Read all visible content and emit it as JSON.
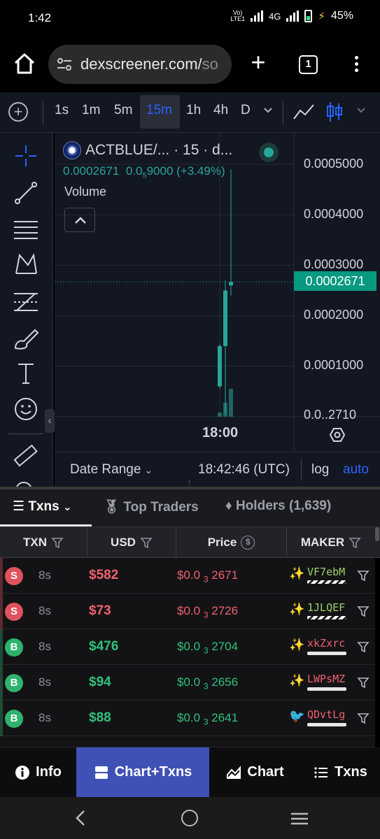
{
  "status_bar": {
    "time": "1:42",
    "volte": "VoLTE1",
    "network": "4G",
    "battery": "45%"
  },
  "browser": {
    "url_main": "dexscreener.com/",
    "url_fade": "so",
    "tab_count": "1"
  },
  "chart_toolbar": {
    "intervals": [
      "1s",
      "1m",
      "5m",
      "15m",
      "1h",
      "4h",
      "D"
    ],
    "active_interval": "15m"
  },
  "chart": {
    "legend_title": "ACTBLUE/...",
    "legend_interval": "· 15 · d...",
    "legend_open": "0.0002671",
    "legend_change_prefix": "0.0",
    "legend_change_sub": "5",
    "legend_change_digits": "9000",
    "legend_change_pct": "(+3.49%)",
    "volume_label": "Volume",
    "last_price_tag": "0.0002671",
    "time_label": "18:00",
    "date_range_label": "Date Range",
    "utc_time": "18:42:46 (UTC)",
    "log_label": "log",
    "auto_label": "auto",
    "accent_up": "#26a69a",
    "accent_blue": "#2962ff"
  },
  "chart_data": {
    "type": "candlestick",
    "title": "ACTBLUE/...",
    "interval": "15",
    "y_ticks": [
      "0.0005000",
      "0.0004000",
      "0.0003000",
      "0.0002000",
      "0.0001000",
      "0.0..2710"
    ],
    "ylim": [
      0.0,
      0.00052
    ],
    "x_tick": "18:00",
    "last_price": 0.0002671,
    "candles": [
      {
        "open": 6e-05,
        "close": 0.00014,
        "high": 0.000145,
        "low": 5.5e-05
      },
      {
        "open": 0.00014,
        "close": 0.00025,
        "high": 0.00027,
        "low": 5e-06
      },
      {
        "open": 0.00026,
        "close": 0.0002671,
        "high": 0.00049,
        "low": 0.00024
      }
    ],
    "volumes": [
      0.12,
      0.4,
      0.8
    ]
  },
  "txn_tabs": {
    "txns": "Txns",
    "top_traders": "Top Traders",
    "holders": "Holders (1,639)"
  },
  "table": {
    "headers": {
      "txn": "TXN",
      "usd": "USD",
      "price": "Price",
      "maker": "MAKER"
    },
    "rows": [
      {
        "type": "S",
        "age": "8s",
        "usd": "$582",
        "price_prefix": "$0.0",
        "price_sub": "3",
        "price_digits": "2671",
        "maker": "VF7ebM",
        "maker_color": "#9bd36a",
        "side": "sell"
      },
      {
        "type": "S",
        "age": "8s",
        "usd": "$73",
        "price_prefix": "$0.0",
        "price_sub": "3",
        "price_digits": "2726",
        "maker": "1JLQEF",
        "maker_color": "#9bd36a",
        "side": "sell"
      },
      {
        "type": "B",
        "age": "8s",
        "usd": "$476",
        "price_prefix": "$0.0",
        "price_sub": "3",
        "price_digits": "2704",
        "maker": "xkZxrc",
        "maker_color": "#f0616d",
        "side": "buy"
      },
      {
        "type": "B",
        "age": "8s",
        "usd": "$94",
        "price_prefix": "$0.0",
        "price_sub": "3",
        "price_digits": "2656",
        "maker": "LWPsMZ",
        "maker_color": "#f0616d",
        "side": "buy"
      },
      {
        "type": "B",
        "age": "8s",
        "usd": "$88",
        "price_prefix": "$0.0",
        "price_sub": "3",
        "price_digits": "2641",
        "maker": "QDvtLg",
        "maker_color": "#f0616d",
        "side": "buy"
      }
    ]
  },
  "bottom_nav": {
    "info": "Info",
    "chart_txns": "Chart+Txns",
    "chart": "Chart",
    "txns": "Txns"
  }
}
